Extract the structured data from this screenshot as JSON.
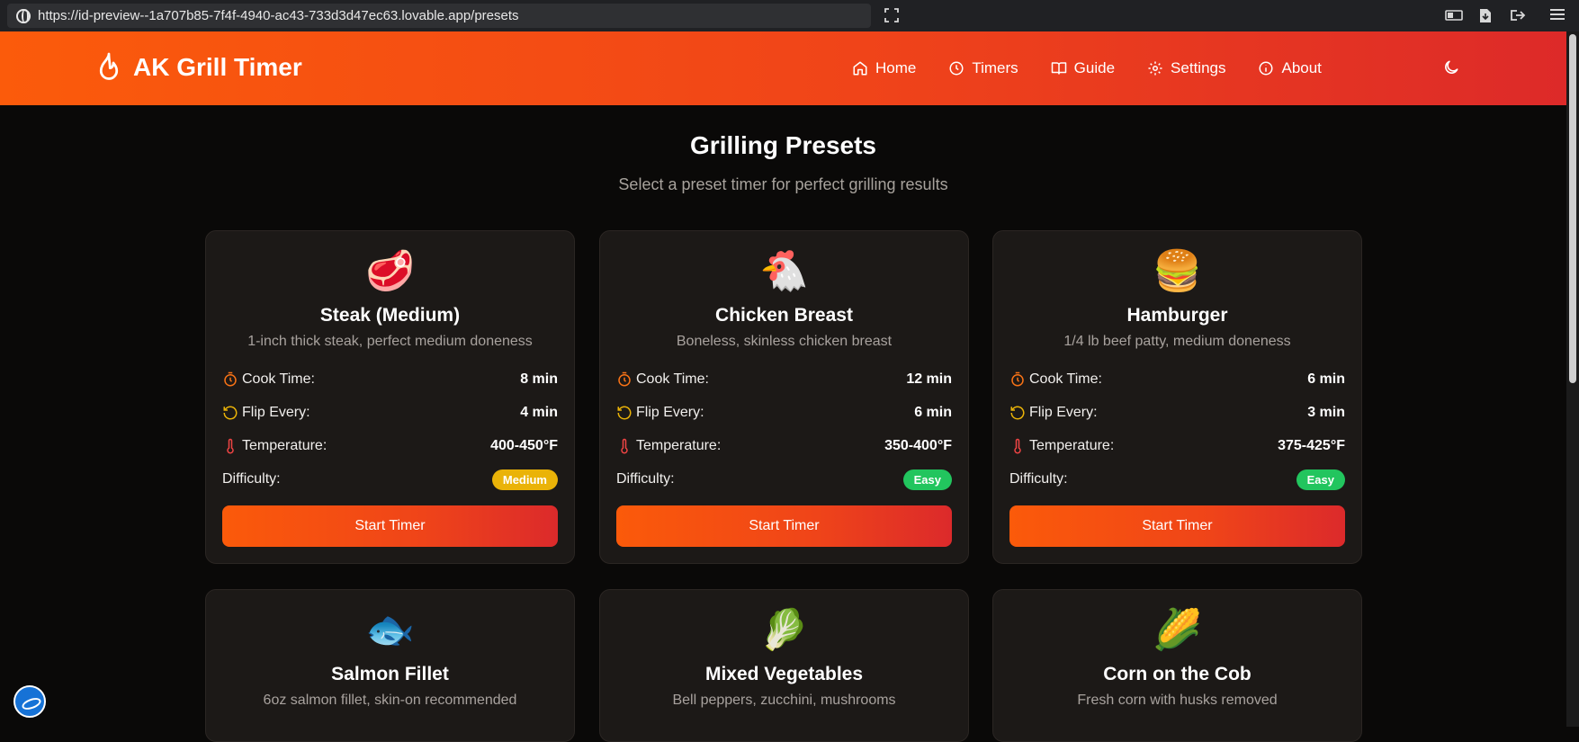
{
  "browser": {
    "url": "https://id-preview--1a707b85-7f4f-4940-ac43-733d3d47ec63.lovable.app/presets"
  },
  "header": {
    "title": "AK Grill Timer",
    "nav": [
      {
        "label": "Home",
        "icon": "home-icon"
      },
      {
        "label": "Timers",
        "icon": "clock-icon"
      },
      {
        "label": "Guide",
        "icon": "book-icon"
      },
      {
        "label": "Settings",
        "icon": "gear-icon"
      },
      {
        "label": "About",
        "icon": "info-icon"
      }
    ],
    "theme_icon": "moon-icon"
  },
  "main": {
    "title": "Grilling Presets",
    "subtitle": "Select a preset timer for perfect grilling results",
    "labels": {
      "cook_time": "Cook Time:",
      "flip_every": "Flip Every:",
      "temperature": "Temperature:",
      "difficulty": "Difficulty:",
      "start": "Start Timer"
    },
    "presets": [
      {
        "emoji": "🥩",
        "name": "Steak (Medium)",
        "desc": "1-inch thick steak, perfect medium doneness",
        "cook": "8 min",
        "flip": "4 min",
        "temp": "400-450°F",
        "difficulty": "Medium",
        "difficulty_color": "#eab308"
      },
      {
        "emoji": "🐔",
        "name": "Chicken Breast",
        "desc": "Boneless, skinless chicken breast",
        "cook": "12 min",
        "flip": "6 min",
        "temp": "350-400°F",
        "difficulty": "Easy",
        "difficulty_color": "#22c55e"
      },
      {
        "emoji": "🍔",
        "name": "Hamburger",
        "desc": "1/4 lb beef patty, medium doneness",
        "cook": "6 min",
        "flip": "3 min",
        "temp": "375-425°F",
        "difficulty": "Easy",
        "difficulty_color": "#22c55e"
      },
      {
        "emoji": "🐟",
        "name": "Salmon Fillet",
        "desc": "6oz salmon fillet, skin-on recommended"
      },
      {
        "emoji": "🥬",
        "name": "Mixed Vegetables",
        "desc": "Bell peppers, zucchini, mushrooms"
      },
      {
        "emoji": "🌽",
        "name": "Corn on the Cob",
        "desc": "Fresh corn with husks removed"
      }
    ]
  },
  "colors": {
    "accent_start": "#fb5b0b",
    "accent_end": "#dd2a29",
    "background": "#0a0908",
    "card": "#1c1917"
  }
}
